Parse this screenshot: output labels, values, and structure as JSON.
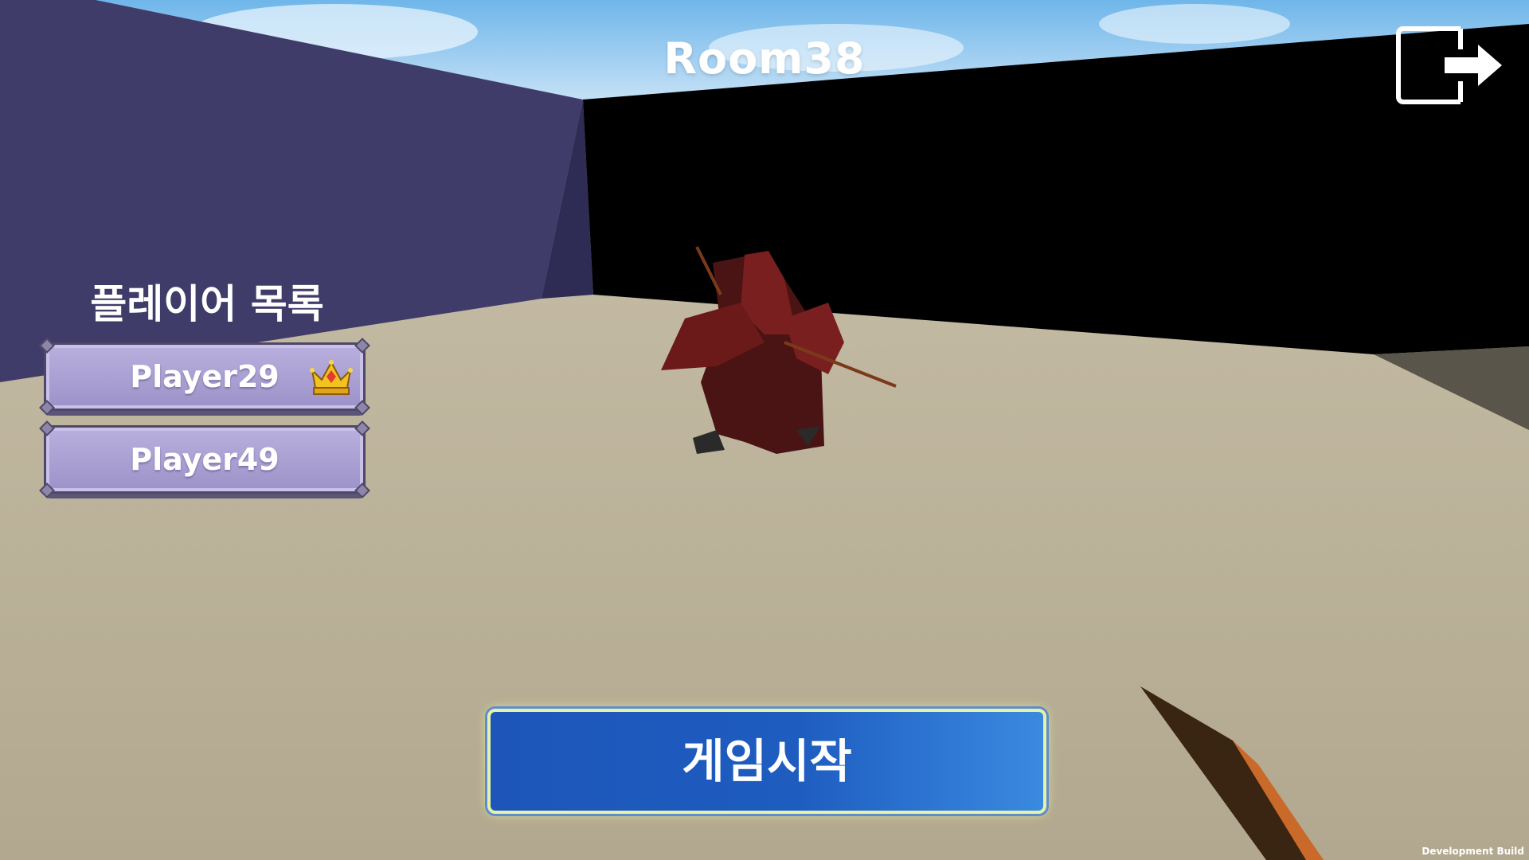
{
  "room": {
    "title": "Room38"
  },
  "player_list": {
    "title": "플레이어 목록",
    "players": [
      {
        "name": "Player29",
        "is_host": true
      },
      {
        "name": "Player49",
        "is_host": false
      }
    ]
  },
  "actions": {
    "start_label": "게임시작",
    "exit_icon": "exit-icon"
  },
  "footer": {
    "build_label": "Development Build"
  },
  "colors": {
    "start_button": "#1e5cc0",
    "player_card": "#aca3d6",
    "left_wall": "#403c6a",
    "floor": "#b5ab93"
  }
}
